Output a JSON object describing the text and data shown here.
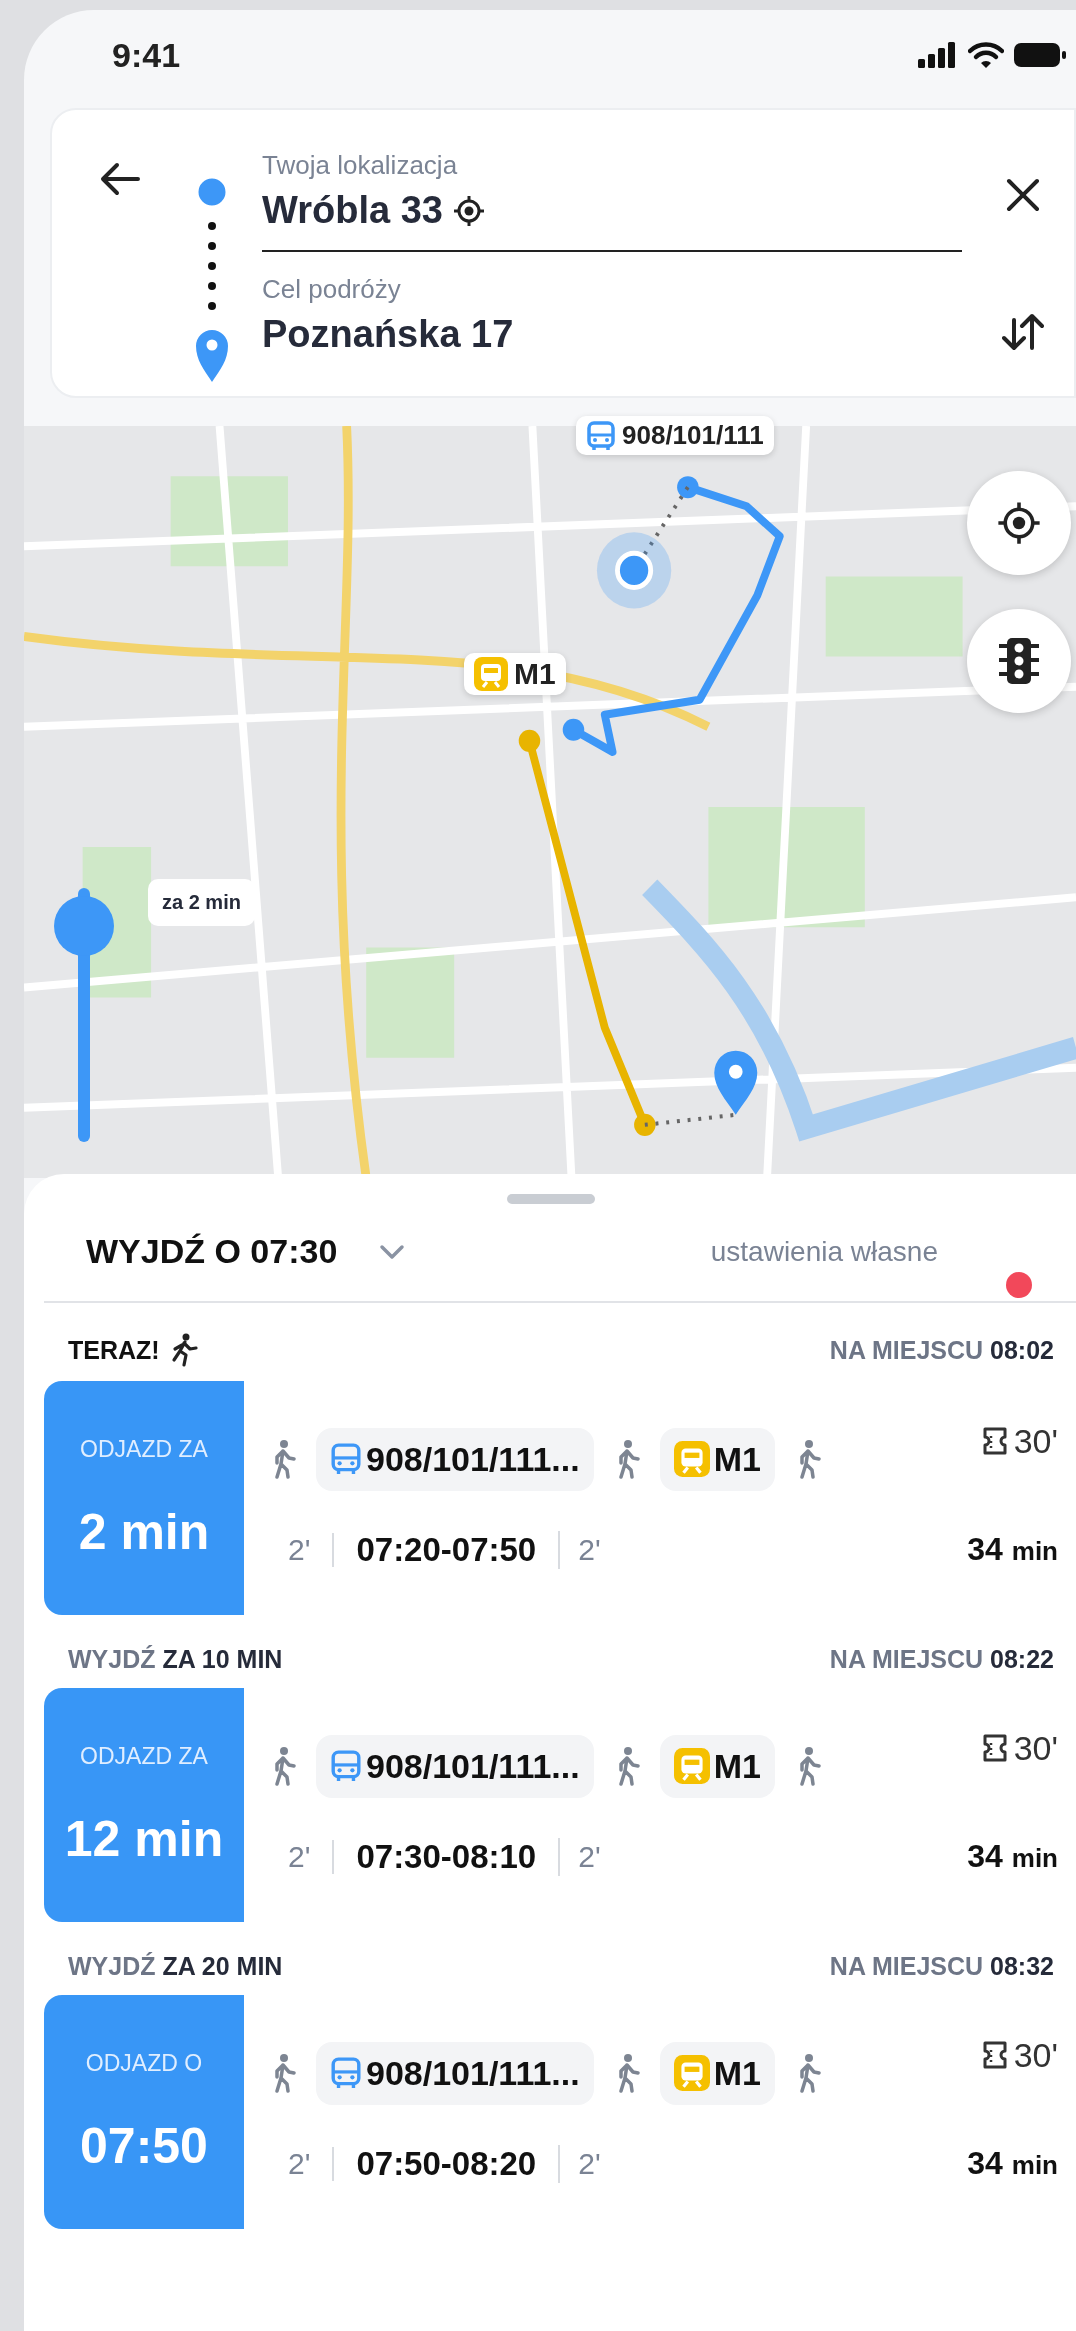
{
  "status_bar": {
    "time": "9:41"
  },
  "route_form": {
    "origin_label": "Twoja lokalizacja",
    "origin_value": "Wróbla 33",
    "destination_label": "Cel podróży",
    "destination_value": "Poznańska 17"
  },
  "map": {
    "bus_label": "908/101/111",
    "metro_label": "M1",
    "time_slider": {
      "level": 0.85,
      "tooltip": "za 2 min"
    }
  },
  "sheet": {
    "departure": "WYJDŹ O 07:30",
    "settings_link": "ustawienia własne"
  },
  "trips": [
    {
      "now": true,
      "heading": "TERAZ!",
      "arrival": "NA MIEJSCU **08:02**",
      "depart_label": "ODJAZD ZA",
      "depart_value": "2 min",
      "legs": [
        {
          "kind": "walk"
        },
        {
          "kind": "bus",
          "text": "908/101/111..."
        },
        {
          "kind": "walk"
        },
        {
          "kind": "metro",
          "text": "M1"
        },
        {
          "kind": "walk"
        }
      ],
      "ticket": "30'",
      "walk_before": "2'",
      "time_range": "07:20-07:50",
      "walk_after": "2'",
      "duration": "34",
      "duration_unit": "min"
    },
    {
      "now": false,
      "heading": "WYJDŹ **ZA 10 MIN**",
      "arrival": "NA MIEJSCU **08:22**",
      "depart_label": "ODJAZD ZA",
      "depart_value": "12 min",
      "legs": [
        {
          "kind": "walk"
        },
        {
          "kind": "bus",
          "text": "908/101/111..."
        },
        {
          "kind": "walk"
        },
        {
          "kind": "metro",
          "text": "M1"
        },
        {
          "kind": "walk"
        }
      ],
      "ticket": "30'",
      "walk_before": "2'",
      "time_range": "07:30-08:10",
      "walk_after": "2'",
      "duration": "34",
      "duration_unit": "min"
    },
    {
      "now": false,
      "heading": "WYJDŹ **ZA 20 MIN**",
      "arrival": "NA MIEJSCU **08:32**",
      "depart_label": "ODJAZD O",
      "depart_value": "07:50",
      "legs": [
        {
          "kind": "walk"
        },
        {
          "kind": "bus",
          "text": "908/101/111..."
        },
        {
          "kind": "walk"
        },
        {
          "kind": "metro",
          "text": "M1"
        },
        {
          "kind": "walk"
        }
      ],
      "ticket": "30'",
      "walk_before": "2'",
      "time_range": "07:50-08:20",
      "walk_after": "2'",
      "duration": "34",
      "duration_unit": "min"
    }
  ]
}
